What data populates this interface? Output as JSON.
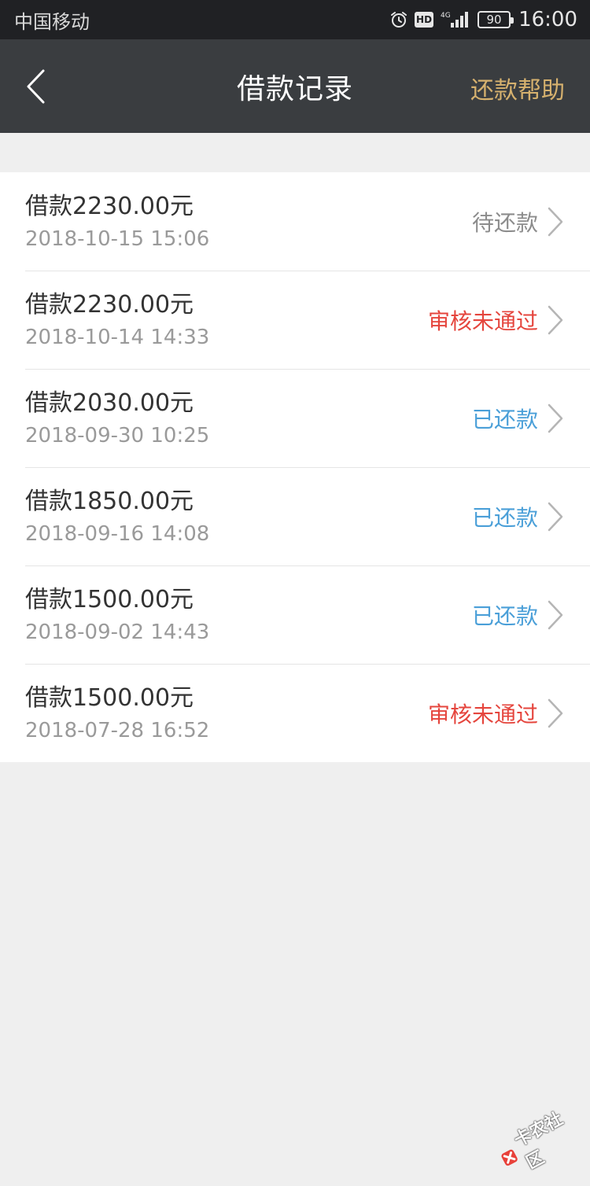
{
  "status_bar": {
    "carrier": "中国移动",
    "hd": "HD",
    "network": "4G",
    "battery": "90",
    "time": "16:00"
  },
  "nav": {
    "title": "借款记录",
    "help": "还款帮助"
  },
  "records": [
    {
      "amount": "借款2230.00元",
      "date": "2018-10-15 15:06",
      "status": "待还款",
      "status_color": "#8c8c8c"
    },
    {
      "amount": "借款2230.00元",
      "date": "2018-10-14 14:33",
      "status": "审核未通过",
      "status_color": "#e5453d"
    },
    {
      "amount": "借款2030.00元",
      "date": "2018-09-30 10:25",
      "status": "已还款",
      "status_color": "#4a9fd8"
    },
    {
      "amount": "借款1850.00元",
      "date": "2018-09-16 14:08",
      "status": "已还款",
      "status_color": "#4a9fd8"
    },
    {
      "amount": "借款1500.00元",
      "date": "2018-09-02 14:43",
      "status": "已还款",
      "status_color": "#4a9fd8"
    },
    {
      "amount": "借款1500.00元",
      "date": "2018-07-28 16:52",
      "status": "审核未通过",
      "status_color": "#e5453d"
    }
  ],
  "watermark": {
    "text": "卡农社区"
  },
  "colors": {
    "nav_bg": "#3a3d40",
    "help_link": "#d6b16e",
    "page_bg": "#efefef"
  }
}
